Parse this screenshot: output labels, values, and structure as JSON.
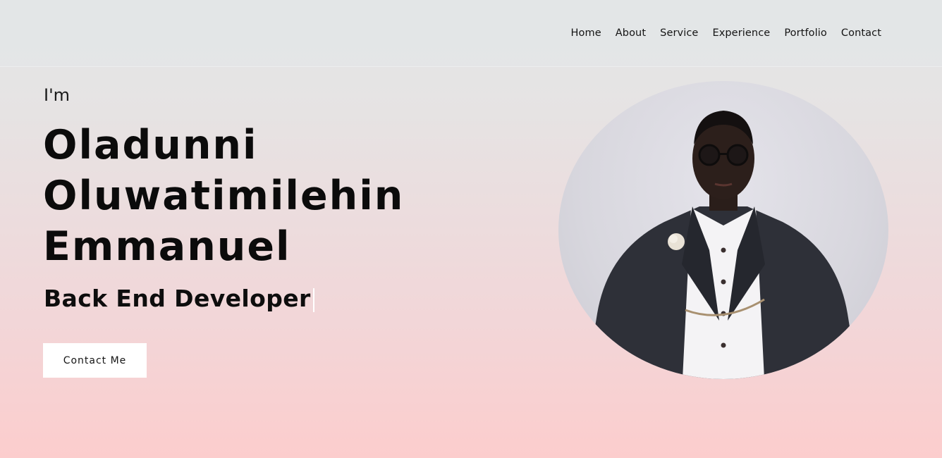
{
  "nav": {
    "items": [
      {
        "label": "Home"
      },
      {
        "label": "About"
      },
      {
        "label": "Service"
      },
      {
        "label": "Experience"
      },
      {
        "label": "Portfolio"
      },
      {
        "label": "Contact"
      }
    ]
  },
  "hero": {
    "intro": "I'm",
    "name_lines": [
      "Oladunni",
      "Oluwatimilehin",
      "Emmanuel"
    ],
    "role": "Back End Developer",
    "cta_label": "Contact Me"
  },
  "colors": {
    "gradient_top": "#e3e6e7",
    "gradient_bottom": "#fccdcd",
    "text": "#111111",
    "button_bg": "#ffffff"
  },
  "icons": {
    "portrait": "profile-photo"
  }
}
